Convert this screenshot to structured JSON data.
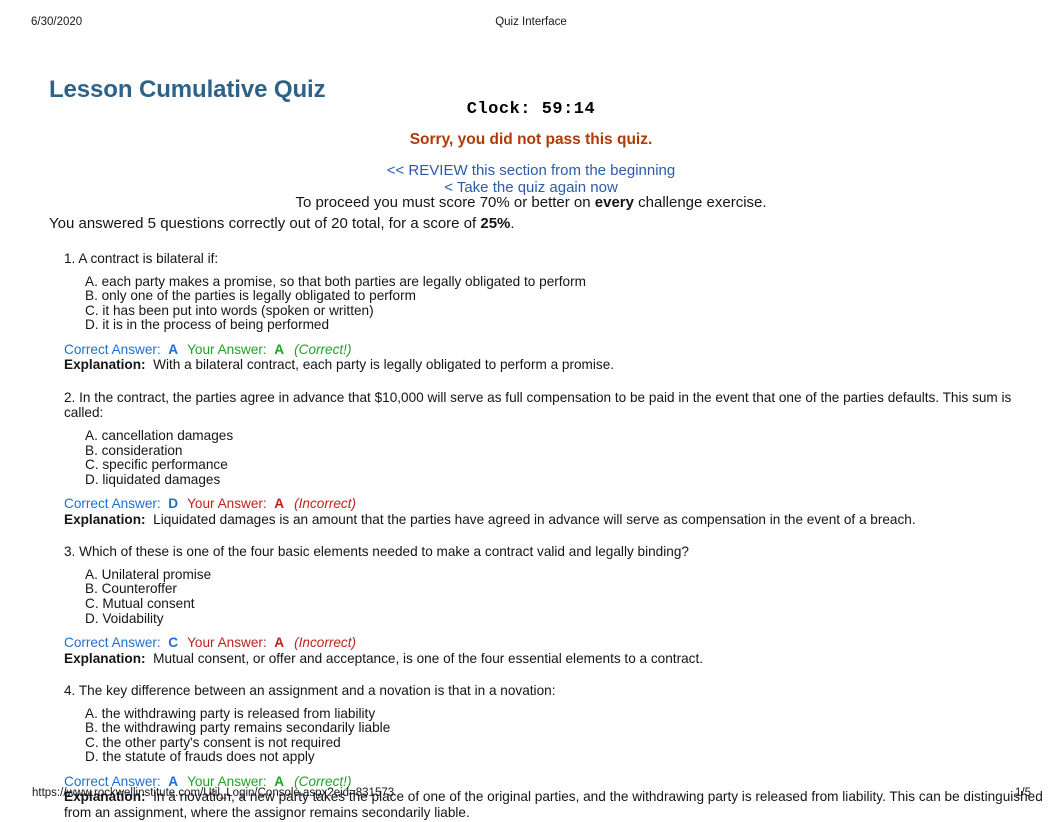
{
  "print_header": {
    "date": "6/30/2020",
    "title": "Quiz Interface"
  },
  "page_title": "Lesson Cumulative Quiz",
  "clock": "Clock: 59:14",
  "fail_message": "Sorry, you did not pass this quiz.",
  "links": [
    {
      "label": "<< REVIEW this section from the beginning"
    },
    {
      "label": "< Take the quiz again now"
    }
  ],
  "proceed": {
    "before": "To proceed you must score 70% or better on ",
    "emphasis": "every",
    "after": " challenge exercise."
  },
  "score": {
    "before": "You answered 5 questions correctly out of 20 total, for a score of ",
    "value": "25%",
    "after": "."
  },
  "labels": {
    "correct_answer": "Correct Answer:",
    "your_answer": "Your Answer:",
    "explanation": "Explanation:"
  },
  "colors": {
    "title_blue": "#2e6389",
    "fail_orange": "#b03a06",
    "link_blue": "#2b5ba9",
    "answer_blue": "#1f6fd0",
    "correct_green": "#22a02c",
    "incorrect_red": "#c0221d"
  },
  "questions": [
    {
      "stem": "1. A contract is bilateral if:",
      "options": [
        "A. each party makes a promise, so that both parties are legally obligated to perform",
        "B. only one of the parties is legally obligated to perform",
        "C. it has been put into words (spoken or written)",
        "D. it is in the process of being performed"
      ],
      "correct_answer": "A",
      "your_answer": "A",
      "verdict": "(Correct!)",
      "is_correct": true,
      "explanation": "With a bilateral contract, each party is legally obligated to perform a promise."
    },
    {
      "stem": "2. In the contract, the parties agree in advance that $10,000 will serve as full compensation to be paid in the event that one of the parties defaults. This sum is called:",
      "options": [
        "A. cancellation damages",
        "B. consideration",
        "C. specific performance",
        "D. liquidated damages"
      ],
      "correct_answer": "D",
      "your_answer": "A",
      "verdict": "(Incorrect)",
      "is_correct": false,
      "explanation": "Liquidated damages is an amount that the parties have agreed in advance will serve as compensation in the event of a breach."
    },
    {
      "stem": "3. Which of these is one of the four basic elements needed to make a contract valid and legally binding?",
      "options": [
        "A. Unilateral promise",
        "B. Counteroffer",
        "C. Mutual consent",
        "D. Voidability"
      ],
      "correct_answer": "C",
      "your_answer": "A",
      "verdict": "(Incorrect)",
      "is_correct": false,
      "explanation": "Mutual consent, or offer and acceptance, is one of the four essential elements to a contract."
    },
    {
      "stem": "4. The key difference between an assignment and a novation is that in a novation:",
      "options": [
        "A. the withdrawing party is released from liability",
        "B. the withdrawing party remains secondarily liable",
        "C. the other party's consent is not required",
        "D. the statute of frauds does not apply"
      ],
      "correct_answer": "A",
      "your_answer": "A",
      "verdict": "(Correct!)",
      "is_correct": true,
      "explanation": "In a novation, a new party takes the place of one of the original parties, and the withdrawing party is released from liability. This can be distinguished from an assignment, where the assignor remains secondarily liable."
    }
  ],
  "print_footer": {
    "url": "https://www.rockwellinstitute.com/Util_Login/Console.aspx?eid=831573",
    "page": "1/5"
  }
}
